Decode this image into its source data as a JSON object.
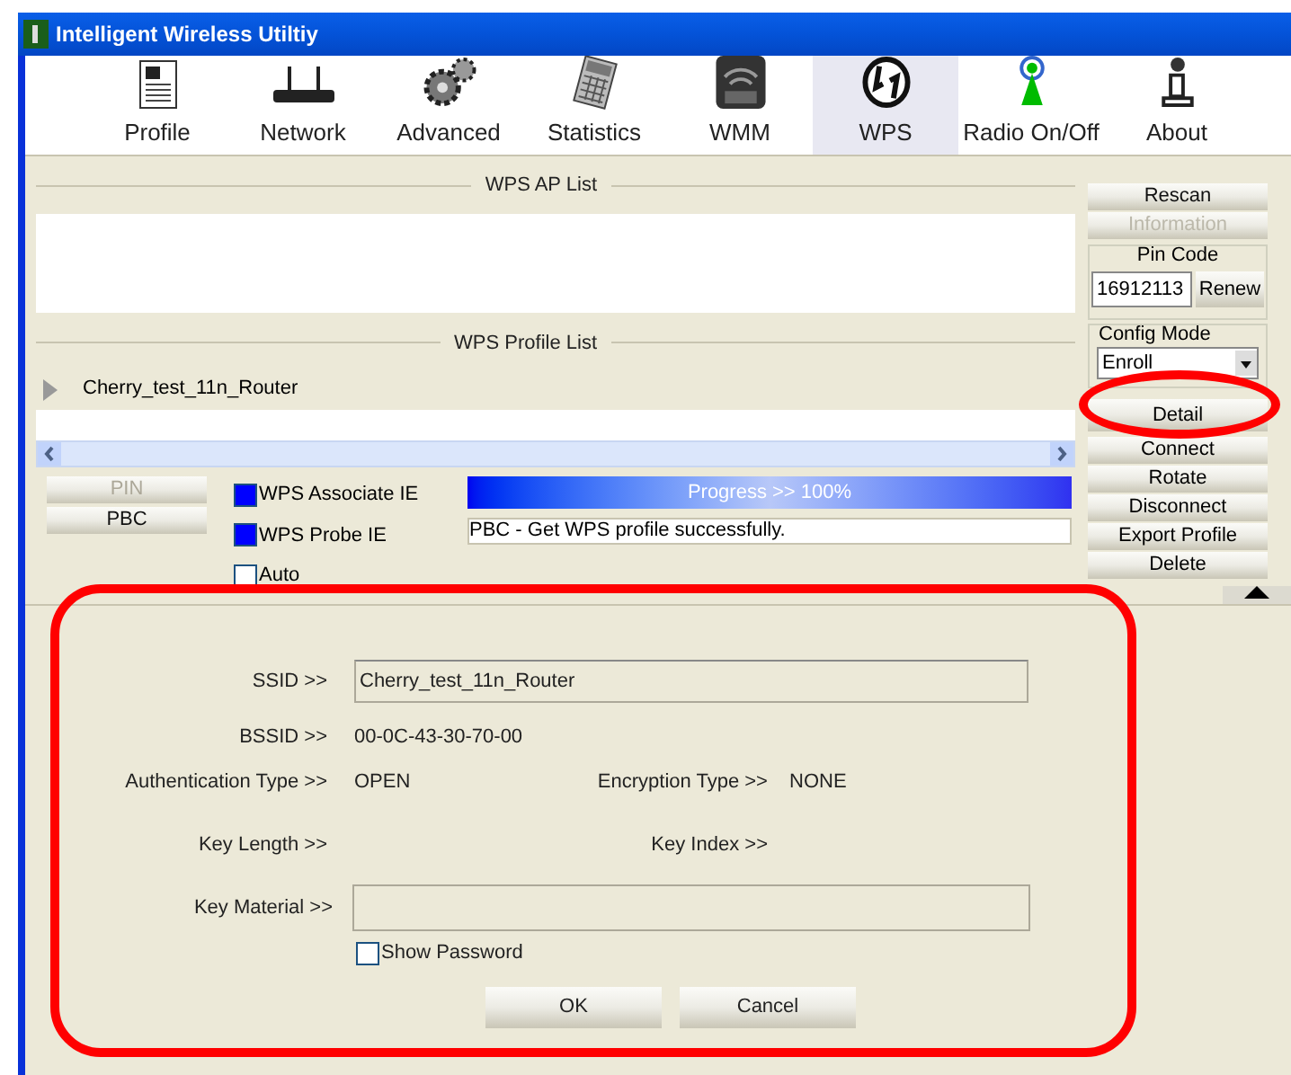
{
  "window": {
    "title": "Intelligent Wireless Utiltiy"
  },
  "toolbar": [
    {
      "label": "Profile",
      "kind": "profile",
      "selected": false
    },
    {
      "label": "Network",
      "kind": "network",
      "selected": false
    },
    {
      "label": "Advanced",
      "kind": "advanced",
      "selected": false
    },
    {
      "label": "Statistics",
      "kind": "statistics",
      "selected": false
    },
    {
      "label": "WMM",
      "kind": "wmm",
      "selected": false
    },
    {
      "label": "WPS",
      "kind": "wps",
      "selected": true
    },
    {
      "label": "Radio On/Off",
      "kind": "radio",
      "selected": false
    },
    {
      "label": "About",
      "kind": "about",
      "selected": false
    }
  ],
  "ap_list": {
    "title": "WPS AP List"
  },
  "profile_list": {
    "title": "WPS Profile List",
    "rows": [
      "Cherry_test_11n_Router"
    ]
  },
  "wps_buttons": [
    {
      "label": "PIN",
      "disabled": true
    },
    {
      "label": "PBC",
      "disabled": false
    }
  ],
  "checkboxes": [
    {
      "label": "WPS Associate IE",
      "checked": true
    },
    {
      "label": "WPS Probe IE",
      "checked": true
    },
    {
      "label": "Auto",
      "checked": false
    }
  ],
  "progress": {
    "label": "Progress >> 100%",
    "level": 1
  },
  "status": "PBC - Get WPS profile successfully.",
  "side_buttons": [
    {
      "label": "Rescan",
      "disabled": false
    },
    {
      "label": "Information",
      "disabled": true
    }
  ],
  "pin_code": {
    "title": "Pin Code",
    "value": "16912113",
    "button": "Renew"
  },
  "config_mode": {
    "title": "Config Mode",
    "value": "Enroll"
  },
  "actions": [
    {
      "label": "Detail",
      "highlighted": true
    },
    {
      "label": "Connect",
      "highlighted": false
    },
    {
      "label": "Rotate",
      "highlighted": false
    },
    {
      "label": "Disconnect",
      "highlighted": false
    },
    {
      "label": "Export Profile",
      "highlighted": false
    },
    {
      "label": "Delete",
      "highlighted": false
    }
  ],
  "details": {
    "ssid_label": "SSID >>",
    "ssid": "Cherry_test_11n_Router",
    "bssid_label": "BSSID >>",
    "bssid": "00-0C-43-30-70-00",
    "auth_label": "Authentication Type >>",
    "auth": "OPEN",
    "enc_label": "Encryption Type >>",
    "enc": "NONE",
    "key_length_label": "Key Length >>",
    "key_index_label": "Key Index >>",
    "key_material_label": "Key Material >>",
    "show_password": {
      "label": "Show Password",
      "checked": false
    }
  },
  "dialog_buttons": [
    "OK",
    "Cancel"
  ]
}
